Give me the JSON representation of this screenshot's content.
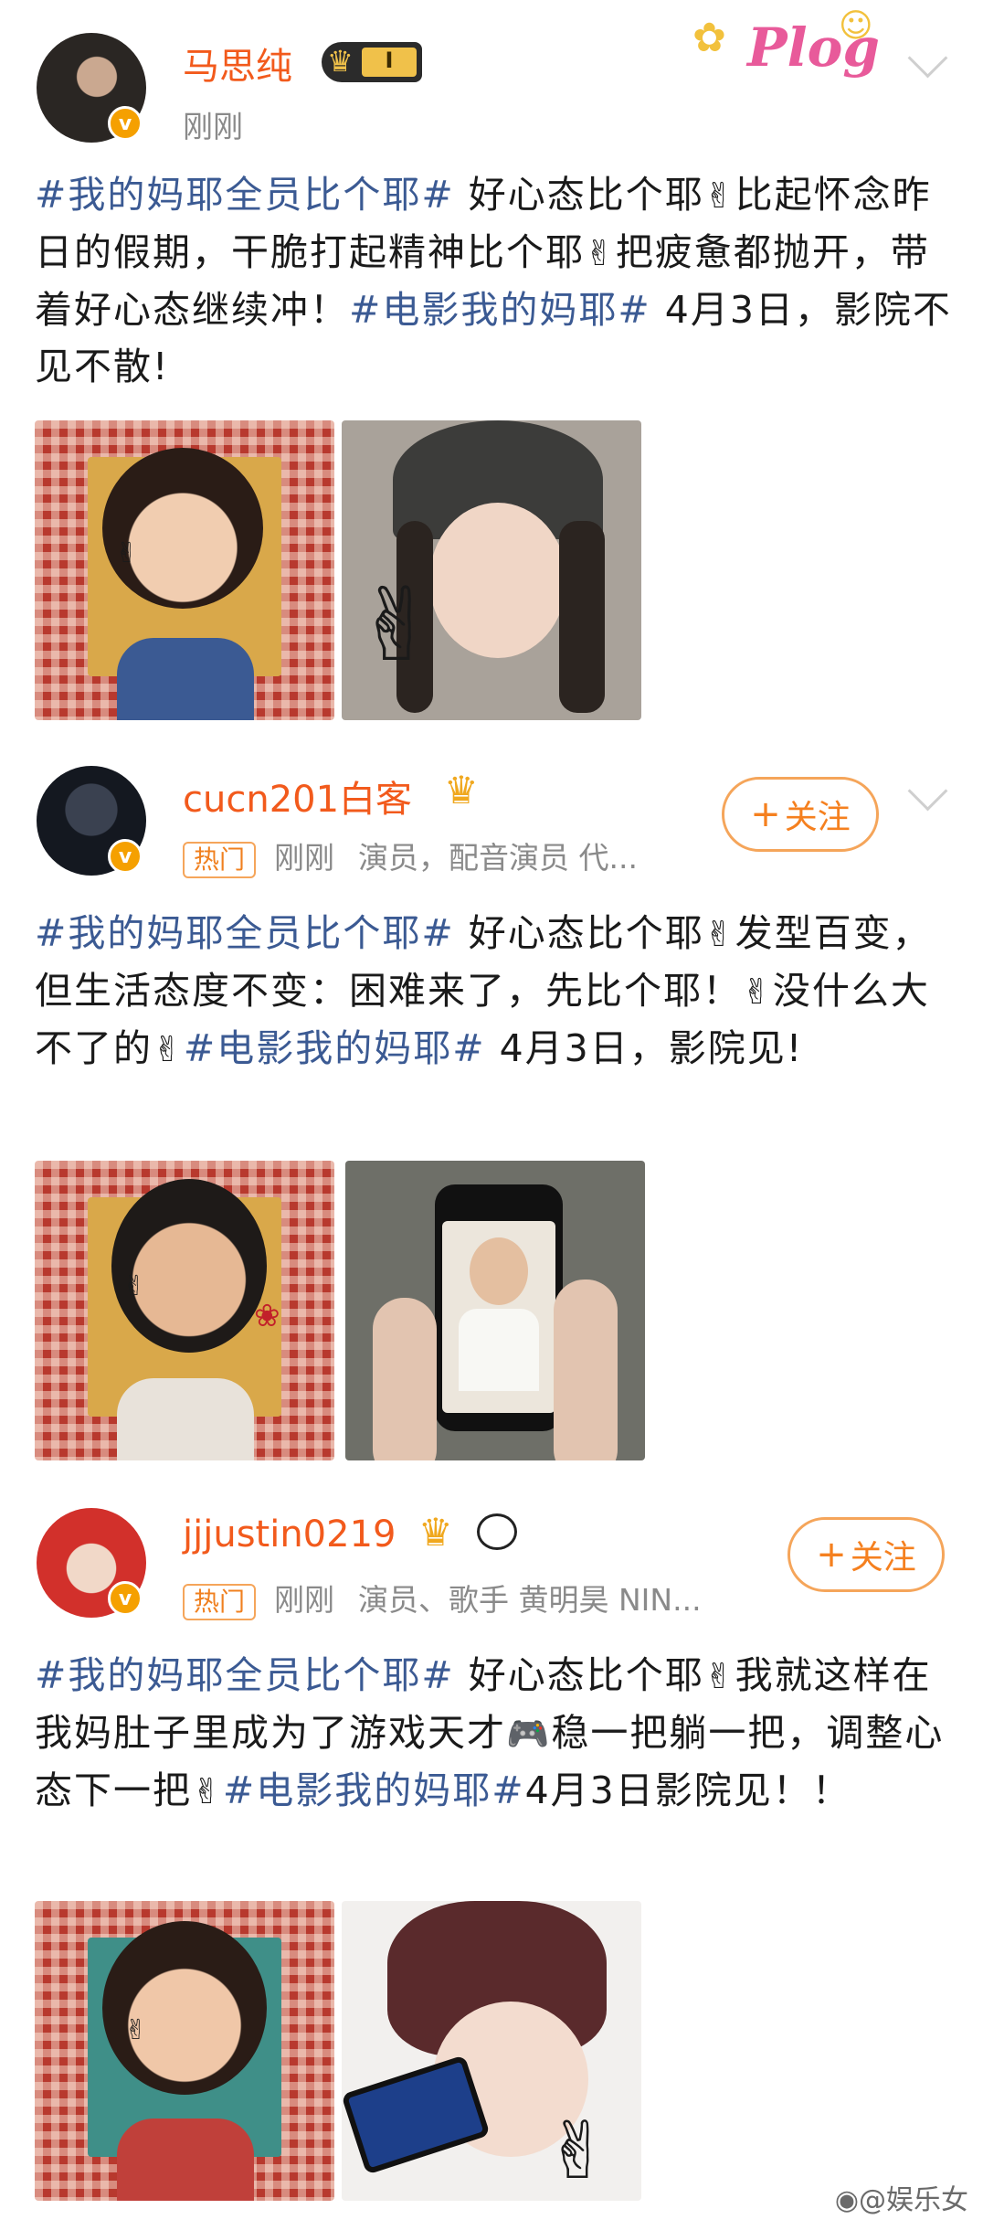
{
  "posts": [
    {
      "username": "马思纯",
      "badge": "I",
      "time": "刚刚",
      "hot": "",
      "bio": "",
      "follow": "",
      "text_parts": [
        "#我的妈耶全员比个耶#",
        " 好心态比个耶",
        "✌",
        "比起怀念昨日的假期，干脆打起精神比个耶",
        "✌",
        "把疲惫都抛开，带着好心态继续冲！",
        "#电影我的妈耶#",
        " 4月3日，影院不见不散!"
      ]
    },
    {
      "username": "cucn201白客",
      "badge": "",
      "time": "刚刚",
      "hot": "热门",
      "bio": "演员，配音演员 代...",
      "follow": "关注",
      "text_parts": [
        "#我的妈耶全员比个耶#",
        " 好心态比个耶",
        "✌",
        "发型百变，但生活态度不变：困难来了，先比个耶！",
        "✌",
        "没什么大不了的",
        "✌",
        "#电影我的妈耶#",
        " 4月3日，影院见!"
      ]
    },
    {
      "username": "jjjustin0219",
      "badge": "",
      "time": "刚刚",
      "hot": "热门",
      "bio": "演员、歌手 黄明昊 NIN...",
      "follow": "关注",
      "text_parts": [
        "#我的妈耶全员比个耶#",
        " 好心态比个耶",
        "✌",
        "我就这样在我妈肚子里成为了游戏天才",
        "🎮",
        "稳一把躺一把，调整心态下一把",
        "✌",
        "#电影我的妈耶#",
        "4月3日影院见！！"
      ]
    }
  ],
  "plog_sticker": "Plog",
  "watermark": "@娱乐女",
  "colors": {
    "name": "#f25a1c",
    "hashtag": "#3b5a93",
    "follow": "#f5801f",
    "meta": "#8a8a8a"
  }
}
